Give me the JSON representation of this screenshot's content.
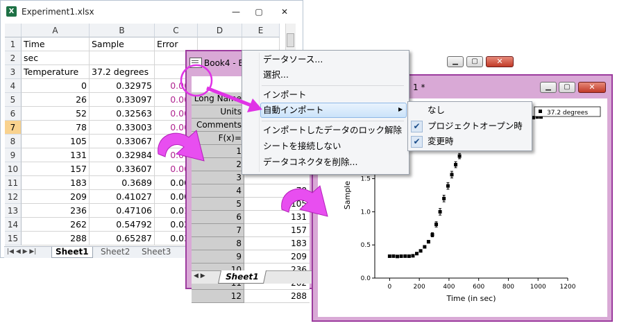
{
  "excel": {
    "title": "Experiment1.xlsx",
    "icon": "excel-icon",
    "min_glyph": "—",
    "max_glyph": "▢",
    "close_glyph": "✕",
    "columns": [
      "A",
      "B",
      "C",
      "D",
      "E"
    ],
    "selected_row": "7",
    "rows": [
      {
        "n": "1",
        "a": "Time",
        "b": "Sample",
        "c": "Error"
      },
      {
        "n": "2",
        "a": "sec",
        "b": "",
        "c": ""
      },
      {
        "n": "3",
        "a": "Temperature",
        "b": "37.2 degrees",
        "c": ""
      },
      {
        "n": "4",
        "a": "0",
        "b": "0.32975",
        "c": "0.001"
      },
      {
        "n": "5",
        "a": "26",
        "b": "0.33097",
        "c": "0.002"
      },
      {
        "n": "6",
        "a": "52",
        "b": "0.32563",
        "c": "0.001"
      },
      {
        "n": "7",
        "a": "78",
        "b": "0.33003",
        "c": "0.002"
      },
      {
        "n": "8",
        "a": "105",
        "b": "0.33067",
        "c": "0.002"
      },
      {
        "n": "9",
        "a": "131",
        "b": "0.32984",
        "c": "0.002"
      },
      {
        "n": "10",
        "a": "157",
        "b": "0.33607",
        "c": "0.001"
      },
      {
        "n": "11",
        "a": "183",
        "b": "0.3689",
        "c": "0.005"
      },
      {
        "n": "12",
        "a": "209",
        "b": "0.41027",
        "c": "0.008"
      },
      {
        "n": "13",
        "a": "236",
        "b": "0.47106",
        "c": "0.014"
      },
      {
        "n": "14",
        "a": "262",
        "b": "0.54792",
        "c": "0.021"
      },
      {
        "n": "15",
        "a": "288",
        "b": "0.65287",
        "c": "0.031"
      }
    ],
    "sheet_tabs": [
      "Sheet1",
      "Sheet2",
      "Sheet3"
    ],
    "nav_glyphs": "|◀ ◀ ▶ ▶|"
  },
  "book": {
    "title": "Book4 - Ex",
    "labels": [
      "Long Name",
      "Units",
      "Comments",
      "F(x)="
    ],
    "row_numbers": [
      "1",
      "2",
      "3",
      "4",
      "5",
      "6",
      "7",
      "8",
      "9",
      "10",
      "11",
      "12"
    ],
    "values": [
      "",
      "",
      "",
      "78",
      "105",
      "131",
      "157",
      "183",
      "209",
      "236",
      "262",
      "288"
    ],
    "sheet_tab": "Sheet1"
  },
  "graph": {
    "title": "1 *",
    "min_glyph": "▁",
    "max_glyph": "▢",
    "close_glyph": "✕"
  },
  "menu": {
    "items": [
      "データソース...",
      "選択...",
      "インポート",
      "自動インポート",
      "インポートしたデータのロック解除",
      "シートを接続しない",
      "データコネクタを削除..."
    ],
    "submenu_arrow": "▶"
  },
  "submenu": {
    "items": [
      "なし",
      "プロジェクトオープン時",
      "変更時"
    ],
    "check": "✔"
  },
  "chart_data": {
    "type": "scatter",
    "xlabel": "Time (in sec)",
    "ylabel": "Sample",
    "xlim": [
      -100,
      1200
    ],
    "ylim": [
      0.0,
      2.5
    ],
    "xticks": [
      0,
      200,
      400,
      600,
      800,
      1000,
      1200
    ],
    "yticks": [
      0.0,
      0.5,
      1.0,
      1.5,
      2.0
    ],
    "legend": "37.2 degrees",
    "legend_position": "top-right",
    "series": [
      {
        "name": "37.2 degrees",
        "x": [
          0,
          26,
          52,
          78,
          105,
          131,
          157,
          183,
          209,
          236,
          262,
          288,
          314,
          340,
          366,
          393,
          419,
          445,
          471,
          497,
          523,
          550,
          576,
          602,
          628,
          654,
          680,
          707,
          733,
          759,
          785,
          811,
          837,
          864,
          890,
          916,
          942,
          968,
          995,
          1020
        ],
        "y": [
          0.33,
          0.331,
          0.326,
          0.33,
          0.331,
          0.33,
          0.336,
          0.369,
          0.41,
          0.471,
          0.548,
          0.653,
          0.81,
          1.0,
          1.2,
          1.39,
          1.56,
          1.71,
          1.84,
          1.96,
          2.05,
          2.12,
          2.18,
          2.22,
          2.26,
          2.29,
          2.31,
          2.33,
          2.35,
          2.36,
          2.37,
          2.38,
          2.39,
          2.4,
          2.41,
          2.41,
          2.42,
          2.42,
          2.43,
          2.43
        ],
        "err": [
          0.002,
          0.002,
          0.002,
          0.002,
          0.002,
          0.002,
          0.002,
          0.005,
          0.008,
          0.014,
          0.021,
          0.031,
          0.04,
          0.05,
          0.05,
          0.05,
          0.05,
          0.045,
          0.04,
          0.035,
          0.03,
          0.03,
          0.028,
          0.025,
          0.022,
          0.02,
          0.02,
          0.018,
          0.016,
          0.015,
          0.014,
          0.013,
          0.012,
          0.012,
          0.011,
          0.011,
          0.01,
          0.01,
          0.01,
          0.01
        ]
      }
    ]
  },
  "colors": {
    "origin_frame": "#9c3b9e",
    "origin_bg": "#d9a9d6",
    "arrow": "#e033e6",
    "highlight": "#cbe3fa"
  }
}
